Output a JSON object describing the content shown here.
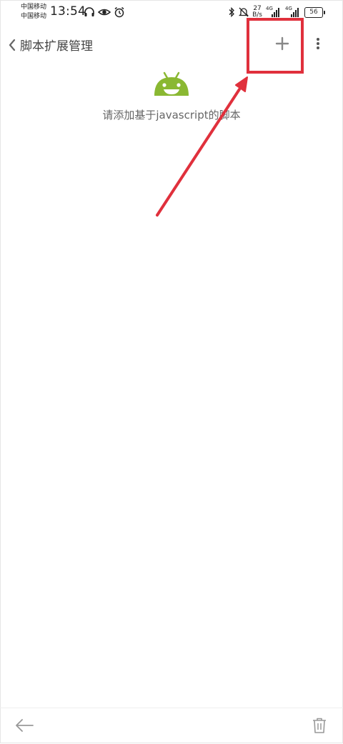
{
  "status_bar": {
    "carrier_1": "中国移动",
    "carrier_2": "中国移动",
    "time": "13:54",
    "speed_value": "27",
    "speed_unit": "B/s",
    "net_1": "4G",
    "net_2": "4G",
    "battery": "56",
    "icons": [
      "headphones-icon",
      "eye-icon",
      "alarm-icon",
      "bluetooth-icon",
      "mute-icon",
      "signal-icon",
      "battery-icon"
    ]
  },
  "header": {
    "title": "脚本扩展管理",
    "back_icon": "chevron-left-icon",
    "add_icon": "plus-icon",
    "more_icon": "more-vertical-icon"
  },
  "empty_state": {
    "icon": "android-icon",
    "message": "请添加基于javascript的脚本"
  },
  "bottom_bar": {
    "back_icon": "arrow-left-icon",
    "delete_icon": "trash-icon"
  },
  "colors": {
    "android_green": "#8ab832",
    "annotation_red": "#e0303c",
    "icon_gray": "#888888"
  }
}
